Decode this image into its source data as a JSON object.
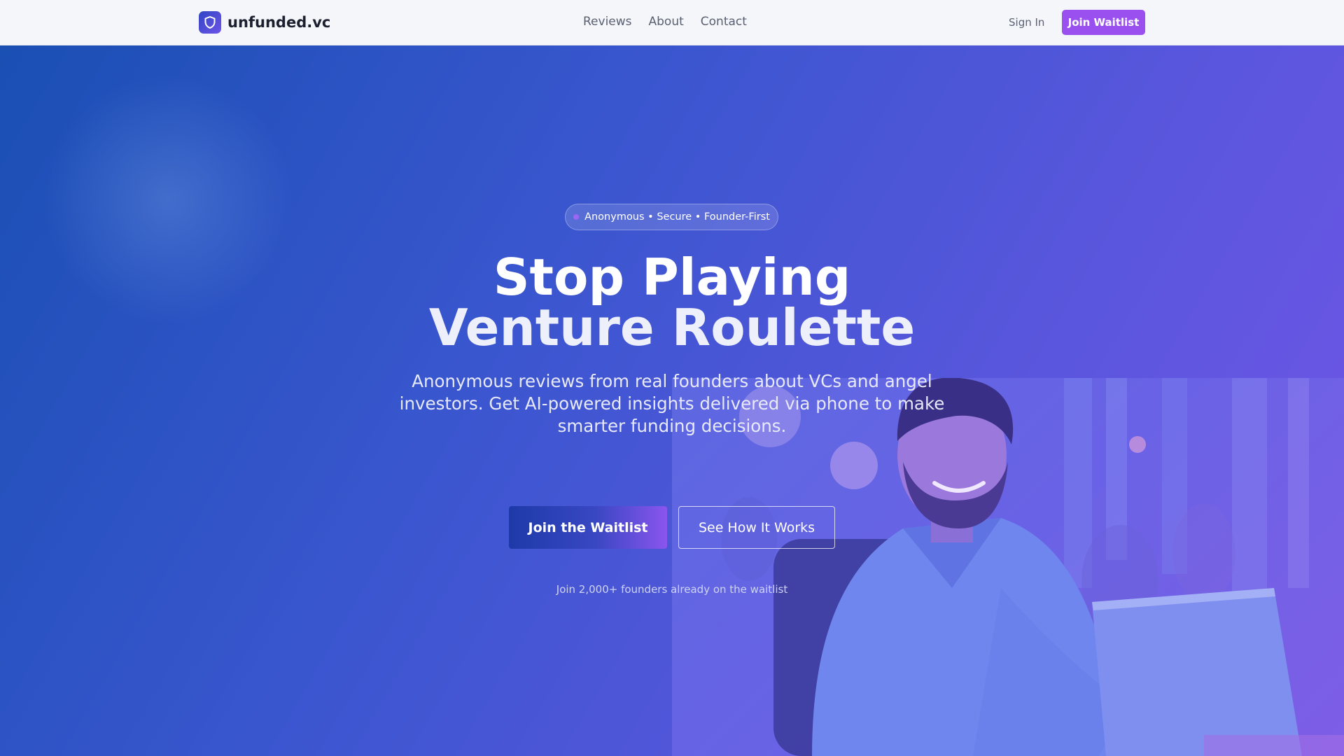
{
  "brand": {
    "name": "unfunded.vc",
    "logo_icon": "shield-icon"
  },
  "nav": {
    "links": [
      {
        "label": "Reviews"
      },
      {
        "label": "About"
      },
      {
        "label": "Contact"
      }
    ],
    "sign_in": "Sign In",
    "cta": "Join Waitlist"
  },
  "hero": {
    "badge": "Anonymous • Secure • Founder-First",
    "headline_line1": "Stop Playing",
    "headline_line2": "Venture Roulette",
    "subtitle": "Anonymous reviews from real founders about VCs and angel investors. Get AI-powered insights delivered via phone to make smarter funding decisions.",
    "primary_button": "Join the Waitlist",
    "secondary_button": "See How It Works",
    "social_proof": "Join 2,000+ founders already on the waitlist"
  },
  "colors": {
    "accent": "#9a50ef",
    "hero_start": "#1a4fb4",
    "hero_end": "#7256e8",
    "nav_bg": "#f5f6fa"
  }
}
